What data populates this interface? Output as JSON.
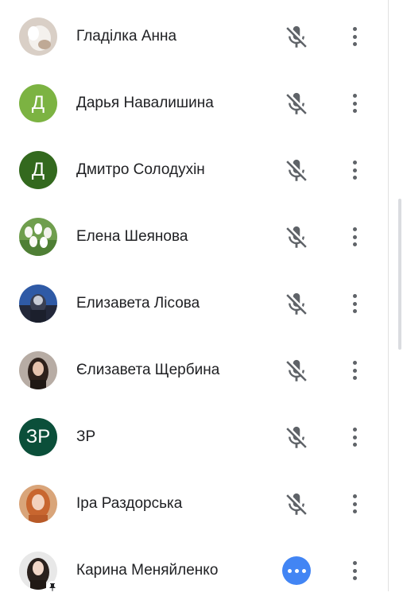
{
  "participants": [
    {
      "name": "Гладілка Анна",
      "avatar": {
        "type": "photo",
        "colors": [
          "#e9e4df",
          "#c9b8a8"
        ]
      },
      "mic": "muted"
    },
    {
      "name": "Дарья Навалишина",
      "avatar": {
        "type": "letter",
        "letter": "Д",
        "color": "#7cb342"
      },
      "mic": "muted"
    },
    {
      "name": "Дмитро Солодухін",
      "avatar": {
        "type": "letter",
        "letter": "Д",
        "color": "#33691e"
      },
      "mic": "muted"
    },
    {
      "name": "Елена Шеянова",
      "avatar": {
        "type": "photo",
        "colors": [
          "#8fbf6a",
          "#f5f5f0"
        ]
      },
      "mic": "muted"
    },
    {
      "name": "Елизавета Лісова",
      "avatar": {
        "type": "photo",
        "colors": [
          "#3a66b0",
          "#2b2f3a"
        ]
      },
      "mic": "muted"
    },
    {
      "name": "Єлизавета Щербина",
      "avatar": {
        "type": "photo",
        "colors": [
          "#b0a39a",
          "#3b2a22"
        ]
      },
      "mic": "muted"
    },
    {
      "name": "ЗР",
      "avatar": {
        "type": "letter",
        "letter": "ЗР",
        "color": "#0b4f3a"
      },
      "mic": "muted"
    },
    {
      "name": "Іра Раздорська",
      "avatar": {
        "type": "photo",
        "colors": [
          "#d38a4f",
          "#f2c9a8"
        ]
      },
      "mic": "muted"
    },
    {
      "name": "Карина Меняйленко",
      "avatar": {
        "type": "photo",
        "colors": [
          "#e6e6e6",
          "#2a211d"
        ]
      },
      "mic": "more",
      "pinned": true
    }
  ],
  "colors": {
    "text": "#202124",
    "icon": "#5f6368",
    "accent": "#4285f4"
  },
  "icons": {
    "mic_off": "mic-off-icon",
    "more": "more-horiz-icon",
    "kebab": "more-vert-icon",
    "pin": "pin-icon"
  }
}
